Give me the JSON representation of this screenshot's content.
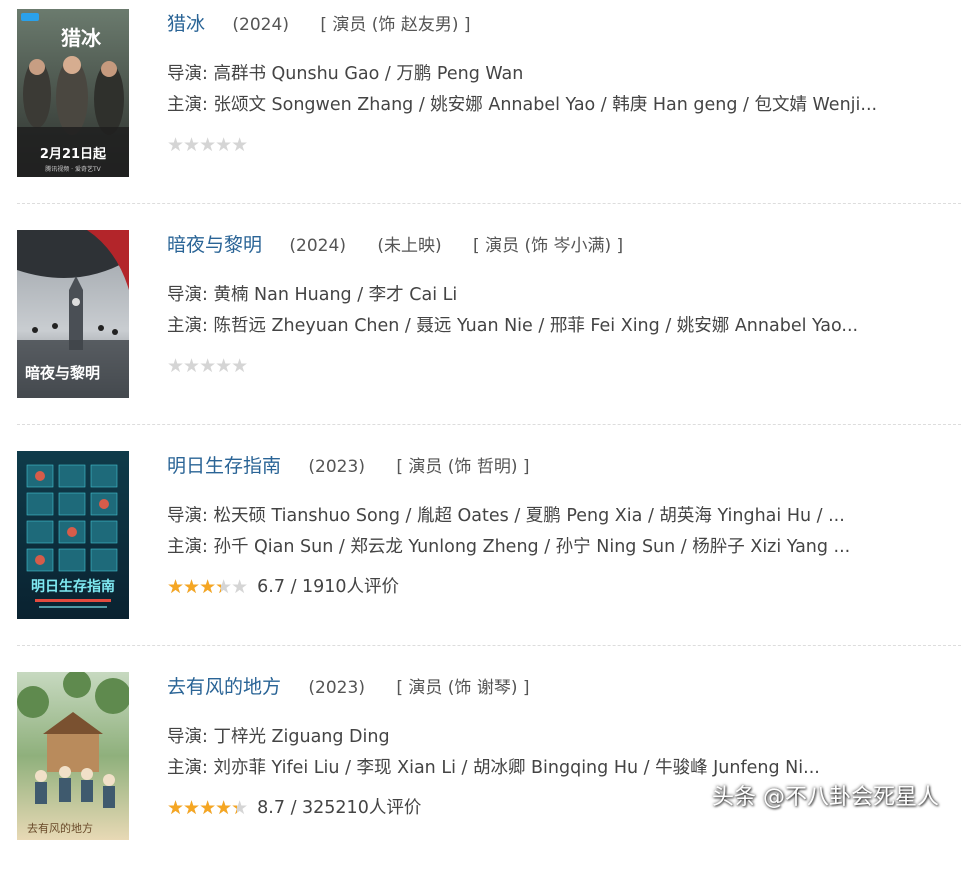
{
  "items": [
    {
      "title": "猎冰",
      "year": "(2024)",
      "status": "",
      "role": "[ 演员 (饰 赵友男) ]",
      "director": "导演: 高群书 Qunshu Gao / 万鹏 Peng Wan",
      "cast": "主演: 张颂文 Songwen Zhang / 姚安娜 Annabel Yao / 韩庚 Han geng / 包文婧 Wenji...",
      "rating_fraction": 0,
      "rating_text": "",
      "poster_icon": "poster-lie-bing"
    },
    {
      "title": "暗夜与黎明",
      "year": "(2024)",
      "status": "(未上映)",
      "role": "[ 演员 (饰 岑小满) ]",
      "director": "导演: 黄楠 Nan Huang / 李才 Cai Li",
      "cast": "主演: 陈哲远 Zheyuan Chen / 聂远 Yuan Nie / 邢菲 Fei Xing / 姚安娜 Annabel Yao...",
      "rating_fraction": 0,
      "rating_text": "",
      "poster_icon": "poster-an-ye-yu-li-ming"
    },
    {
      "title": "明日生存指南",
      "year": "(2023)",
      "status": "",
      "role": "[ 演员 (饰 哲明) ]",
      "director": "导演: 松天硕 Tianshuo Song / 胤超 Oates / 夏鹏 Peng Xia / 胡英海 Yinghai Hu / ...",
      "cast": "主演: 孙千 Qian Sun / 郑云龙 Yunlong Zheng / 孙宁 Ning Sun / 杨肸子 Xizi Yang ...",
      "rating_fraction": 0.67,
      "rating_text": "6.7 / 1910人评价",
      "poster_icon": "poster-ming-ri-sheng-cun-zhi-nan"
    },
    {
      "title": "去有风的地方",
      "year": "(2023)",
      "status": "",
      "role": "[ 演员 (饰 谢琴) ]",
      "director": "导演: 丁梓光 Ziguang Ding",
      "cast": "主演: 刘亦菲 Yifei Liu / 李现 Xian Li / 胡冰卿 Bingqing Hu / 牛骏峰 Junfeng Ni...",
      "rating_fraction": 0.87,
      "rating_text": "8.7 / 325210人评价",
      "poster_icon": "poster-qu-you-feng-de-di-fang"
    }
  ],
  "poster_texts": {
    "p1_title": "猎冰",
    "p1_date": "2月21日起",
    "p1_small": "腾讯视频 · 爱奇艺TV",
    "p2_title": "暗夜与黎明",
    "p3_title": "明日生存指南",
    "p4_title": "去有风的地方"
  },
  "colors": {
    "title_link": "#2a6496",
    "star_filled": "#f5a623",
    "star_empty": "#d5d5d5"
  },
  "watermark": "头条 @不八卦会死星人"
}
